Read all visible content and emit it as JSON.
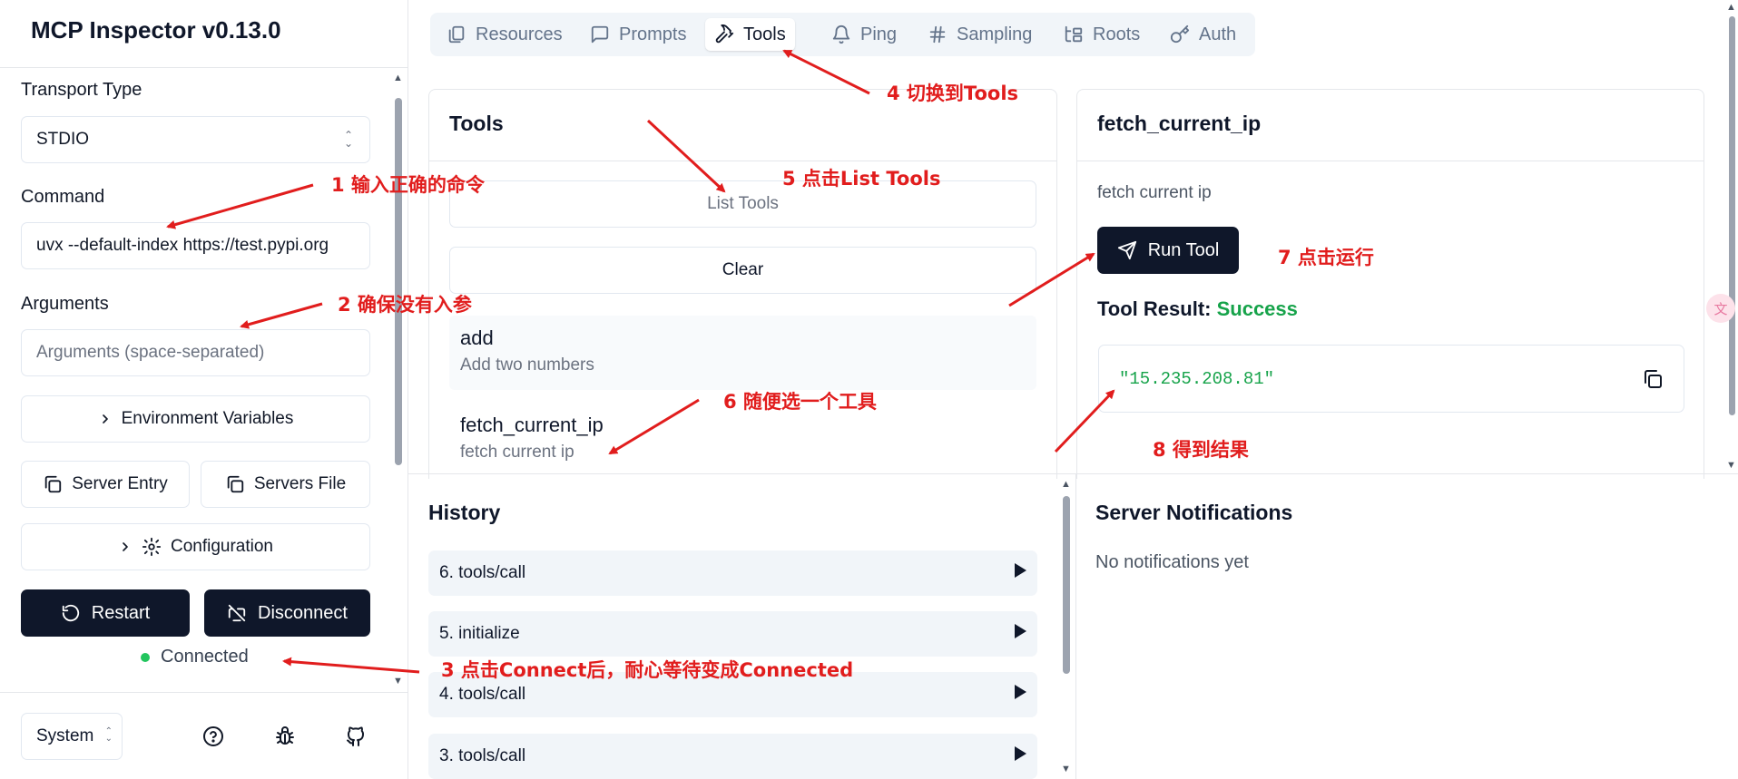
{
  "app": {
    "title": "MCP Inspector v0.13.0"
  },
  "sidebar": {
    "transport_label": "Transport Type",
    "transport_value": "STDIO",
    "command_label": "Command",
    "command_value": "uvx --default-index https://test.pypi.org",
    "arguments_label": "Arguments",
    "arguments_placeholder": "Arguments (space-separated)",
    "env_vars_label": "Environment Variables",
    "server_entry_label": "Server Entry",
    "servers_file_label": "Servers File",
    "configuration_label": "Configuration",
    "restart_label": "Restart",
    "disconnect_label": "Disconnect",
    "status_text": "Connected",
    "theme_value": "System"
  },
  "tabs": [
    {
      "label": "Resources",
      "icon": "files-icon"
    },
    {
      "label": "Prompts",
      "icon": "message-square-icon"
    },
    {
      "label": "Tools",
      "icon": "hammer-icon",
      "active": true
    },
    {
      "label": "Ping",
      "icon": "bell-icon"
    },
    {
      "label": "Sampling",
      "icon": "hash-icon"
    },
    {
      "label": "Roots",
      "icon": "folder-tree-icon"
    },
    {
      "label": "Auth",
      "icon": "key-icon"
    }
  ],
  "tools_panel": {
    "title": "Tools",
    "list_tools_label": "List Tools",
    "clear_label": "Clear",
    "items": [
      {
        "name": "add",
        "description": "Add two numbers"
      },
      {
        "name": "fetch_current_ip",
        "description": "fetch current ip"
      }
    ]
  },
  "detail_panel": {
    "title": "fetch_current_ip",
    "description": "fetch current ip",
    "run_label": "Run Tool",
    "result_label": "Tool Result:",
    "result_status": "Success",
    "result_value": "\"15.235.208.81\""
  },
  "history": {
    "title": "History",
    "items": [
      "6. tools/call",
      "5. initialize",
      "4. tools/call",
      "3. tools/call"
    ]
  },
  "notifications": {
    "title": "Server Notifications",
    "empty_text": "No notifications yet"
  },
  "annotations": [
    "1 输入正确的命令",
    "2 确保没有入参",
    "3 点击Connect后，耐心等待变成Connected",
    "4 切换到Tools",
    "5 点击List Tools",
    "6 随便选一个工具",
    "7 点击运行",
    "8 得到结果"
  ],
  "colors": {
    "accent_dark": "#0f172a",
    "success": "#16a34a",
    "connected": "#22c55e",
    "annotation": "#e11d1d"
  }
}
